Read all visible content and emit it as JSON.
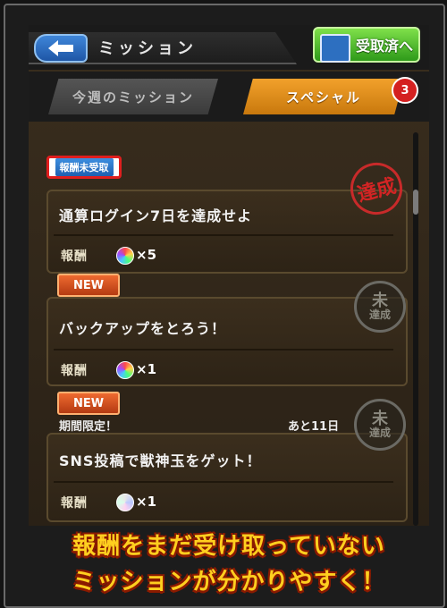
{
  "header": {
    "back_label": "◀",
    "title": "ミッション",
    "received_button": "受取済へ"
  },
  "tabs": [
    {
      "label": "今週のミッション",
      "active": false
    },
    {
      "label": "スペシャル",
      "active": true,
      "badge": "3"
    }
  ],
  "missions": [
    {
      "tag": "報酬未受取",
      "title": "通算ログイン7日を達成せよ",
      "reward_label": "報酬",
      "reward_amount": "×5",
      "status_stamp": "達成"
    },
    {
      "tag": "NEW",
      "title": "バックアップをとろう！",
      "reward_label": "報酬",
      "reward_amount": "×1",
      "status_stamp_top": "未",
      "status_stamp_bottom": "達成"
    },
    {
      "tag": "NEW",
      "limited": "期間限定！",
      "remaining": "あと11日",
      "title": "SNS投稿で獣神玉をゲット！",
      "reward_label": "報酬",
      "reward_amount": "×1",
      "status_stamp_top": "未",
      "status_stamp_bottom": "達成"
    }
  ],
  "caption": {
    "line1": "報酬をまだ受け取っていない",
    "line2": "ミッションが分かりやすく！"
  },
  "colors": {
    "accent_orange": "#f2a12b",
    "caption_yellow": "#ffcf1f",
    "stamp_red": "#d32424"
  }
}
